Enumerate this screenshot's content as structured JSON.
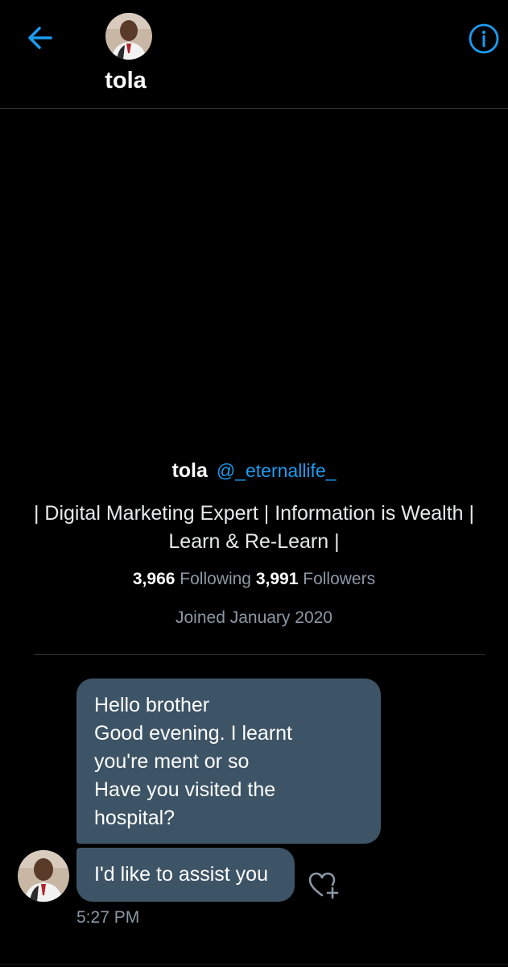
{
  "header": {
    "back_icon": "arrow-left-icon",
    "avatar_icon": "profile-photo",
    "name": "tola",
    "info_icon": "info-circle-icon"
  },
  "profile": {
    "name": "tola",
    "handle": "@_eternallife_",
    "bio_line_1": "| Digital Marketing Expert | Information is Wealth |",
    "bio_line_2": "Learn & Re-Learn |",
    "following_count": "3,966",
    "following_label": "Following",
    "followers_count": "3,991",
    "followers_label": "Followers",
    "joined": "Joined January 2020"
  },
  "messages": [
    {
      "lines": [
        "Hello brother",
        "Good evening. I learnt",
        "you're ment or so",
        "Have you visited the",
        "hospital?"
      ]
    },
    {
      "text": "I'd like to assist you"
    }
  ],
  "message_meta": {
    "timestamp": "5:27 PM",
    "like_icon": "heart-plus-icon"
  },
  "colors": {
    "background": "#000000",
    "accent": "#1d9bf0",
    "bubble": "#3d5466",
    "muted": "#8b98a5",
    "divider": "#2f3336"
  }
}
